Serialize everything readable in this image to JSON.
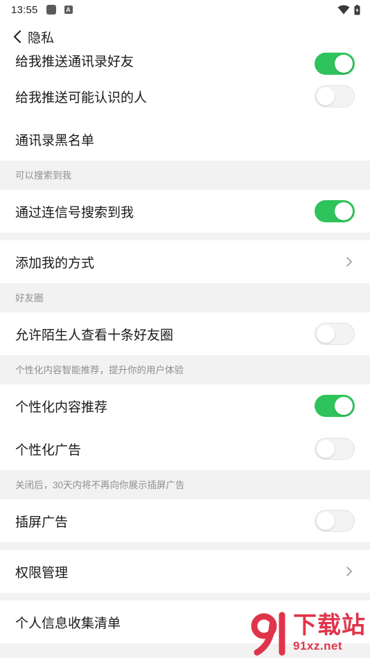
{
  "status_bar": {
    "time": "13:55",
    "badge_letter": "A"
  },
  "header": {
    "title": "隐私"
  },
  "rows": {
    "push_contacts": {
      "label": "给我推送通讯录好友",
      "enabled": true
    },
    "push_people_may_know": {
      "label": "给我推送可能认识的人",
      "enabled": false
    },
    "contacts_blacklist": {
      "label": "通讯录黑名单"
    },
    "search_by_id": {
      "label": "通过连信号搜索到我",
      "enabled": true
    },
    "add_me_methods": {
      "label": "添加我的方式"
    },
    "stranger_view_moments": {
      "label": "允许陌生人查看十条好友圈",
      "enabled": false
    },
    "personalized_content": {
      "label": "个性化内容推荐",
      "enabled": true
    },
    "personalized_ads": {
      "label": "个性化广告",
      "enabled": false
    },
    "interstitial_ads": {
      "label": "插屏广告",
      "enabled": false
    },
    "permission_management": {
      "label": "权限管理"
    },
    "personal_info_list": {
      "label": "个人信息收集清单"
    }
  },
  "sections": {
    "searchable": "可以搜索到我",
    "moments": "好友圈",
    "personalization": "个性化内容智能推荐，提升你的用户体验",
    "interstitial_note": "关闭后，30天内将不再向你展示插屏广告"
  },
  "watermark": {
    "logo_text": "91",
    "top": "下载站",
    "bottom": "91xz.net"
  },
  "colors": {
    "toggle_on": "#2fc35b",
    "toggle_off": "#f3f3f3",
    "section_text": "#8f8f8f",
    "watermark": "#e0344a"
  }
}
